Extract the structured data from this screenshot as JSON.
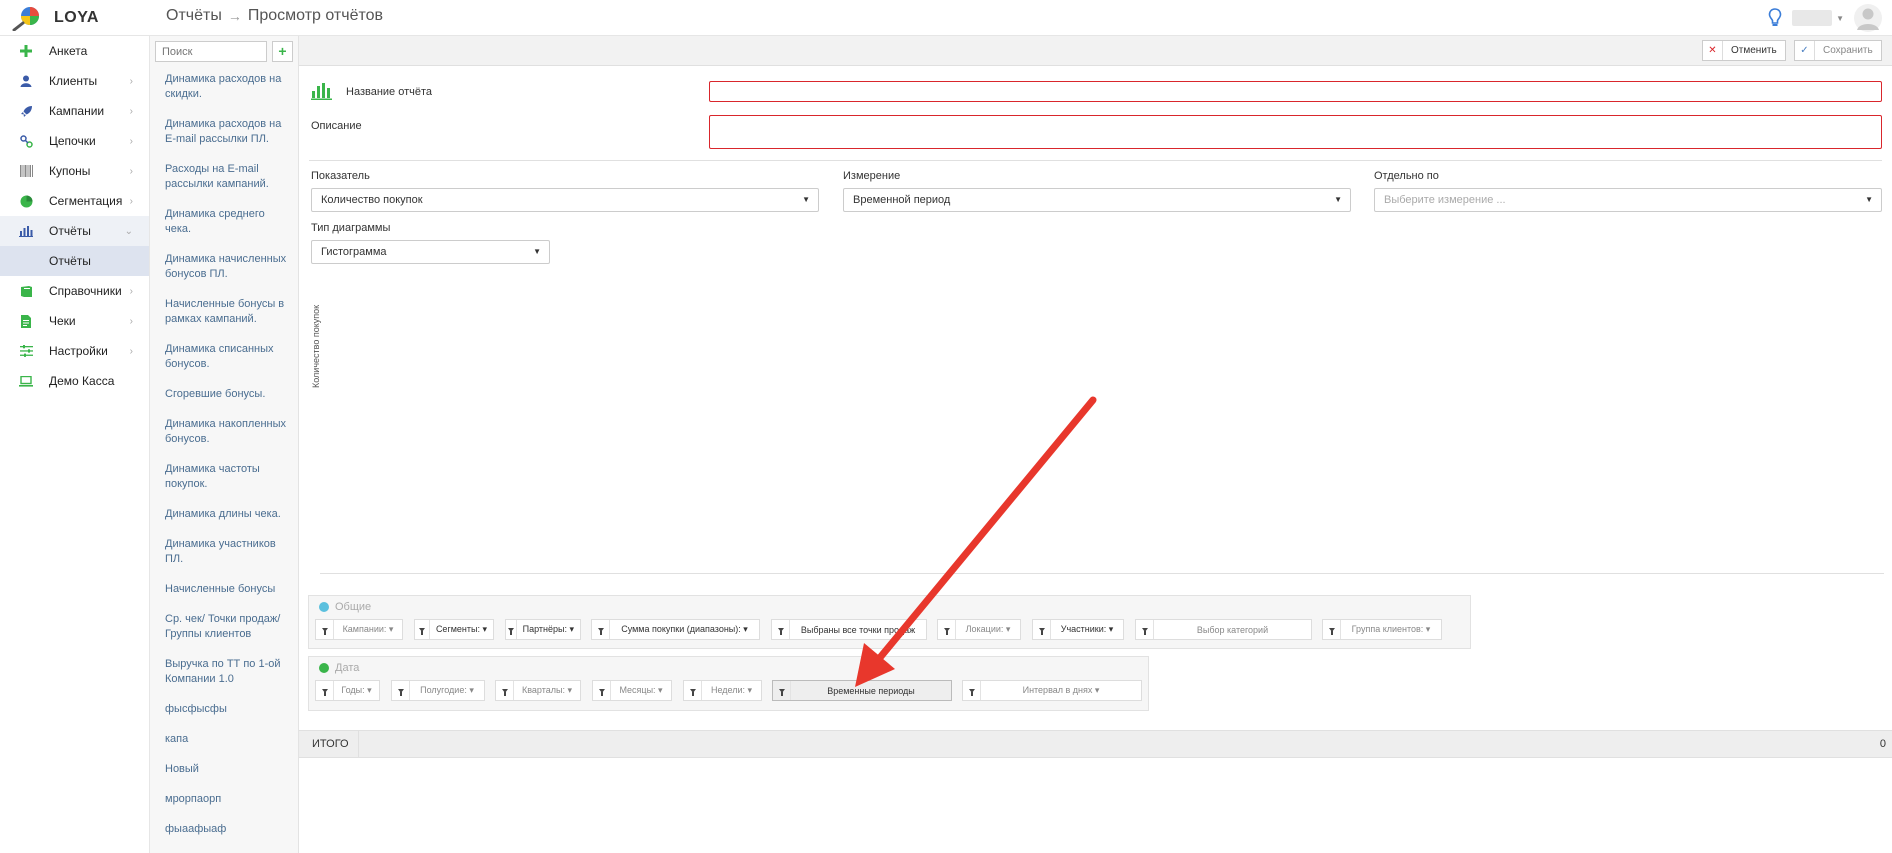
{
  "app": {
    "logo_text": "LOYA",
    "breadcrumb": [
      "Отчёты",
      "Просмотр отчётов"
    ]
  },
  "nav": {
    "items": [
      {
        "label": "Анкета",
        "icon": "plus-icon",
        "has_chevron": false
      },
      {
        "label": "Клиенты",
        "icon": "user-icon",
        "has_chevron": true
      },
      {
        "label": "Кампании",
        "icon": "rocket-icon",
        "has_chevron": true
      },
      {
        "label": "Цепочки",
        "icon": "chain-icon",
        "has_chevron": true
      },
      {
        "label": "Купоны",
        "icon": "barcode-icon",
        "has_chevron": true
      },
      {
        "label": "Сегментация",
        "icon": "pie-chart-icon",
        "has_chevron": true
      },
      {
        "label": "Отчёты",
        "icon": "bar-chart-icon",
        "has_chevron": true,
        "active": true
      },
      {
        "label": "Справочники",
        "icon": "book-icon",
        "has_chevron": true
      },
      {
        "label": "Чеки",
        "icon": "receipt-icon",
        "has_chevron": true
      },
      {
        "label": "Настройки",
        "icon": "sliders-icon",
        "has_chevron": true
      },
      {
        "label": "Демо Касса",
        "icon": "laptop-icon",
        "has_chevron": false
      }
    ],
    "sub_item": "Отчёты"
  },
  "report_list": {
    "search_placeholder": "Поиск",
    "add_label": "+",
    "items": [
      "Динамика расходов на скидки.",
      "Динамика расходов на E-mail рассылки ПЛ.",
      "Расходы на E-mail рассылки кампаний.",
      "Динамика среднего чека.",
      "Динамика начисленных бонусов ПЛ.",
      "Начисленные бонусы в рамках кампаний.",
      "Динамика списанных бонусов.",
      "Сгоревшие бонусы.",
      "Динамика накопленных бонусов.",
      "Динамика частоты покупок.",
      "Динамика длины чека.",
      "Динамика участников ПЛ.",
      "Начисленные бонусы",
      "Ср. чек/ Точки продаж/ Группы клиентов",
      "Выручка по ТТ по 1-ой Компании 1.0",
      "фысфысфы",
      "капа",
      "Новый",
      "мрорпаорп",
      "фыаафыаф"
    ]
  },
  "actions": {
    "cancel_label": "Отменить",
    "save_label": "Сохранить"
  },
  "form": {
    "report_name_label": "Название отчёта",
    "report_name_value": "",
    "description_label": "Описание",
    "description_value": "",
    "indicator_label": "Показатель",
    "indicator_value": "Количество покупок",
    "dimension_label": "Измерение",
    "dimension_value": "Временной период",
    "split_label": "Отдельно по",
    "split_placeholder": "Выберите измерение ...",
    "chart_type_label": "Тип диаграммы",
    "chart_type_value": "Гистограмма"
  },
  "chart": {
    "y_axis_label": "Количество покупок"
  },
  "filters": {
    "general": {
      "title": "Общие",
      "color": "#5bc0de",
      "chips": [
        {
          "label": "Кампании: ▾",
          "muted": true
        },
        {
          "label": "Сегменты: ▾",
          "muted": false
        },
        {
          "label": "Партнёры: ▾",
          "muted": false
        },
        {
          "label": "Сумма покупки (диапазоны): ▾",
          "muted": false
        },
        {
          "label": "Выбраны все точки продаж",
          "muted": false
        },
        {
          "label": "Локации: ▾",
          "muted": true
        },
        {
          "label": "Участники: ▾",
          "muted": false
        },
        {
          "label": "Выбор категорий",
          "muted": true
        },
        {
          "label": "Группа клиентов: ▾",
          "muted": true
        }
      ]
    },
    "date": {
      "title": "Дата",
      "color": "#3ab54a",
      "chips": [
        {
          "label": "Годы: ▾",
          "muted": true
        },
        {
          "label": "Полугодие: ▾",
          "muted": true
        },
        {
          "label": "Кварталы: ▾",
          "muted": true
        },
        {
          "label": "Месяцы: ▾",
          "muted": true
        },
        {
          "label": "Недели: ▾",
          "muted": true
        },
        {
          "label": "Временные периоды",
          "muted": false,
          "active": true
        },
        {
          "label": "Интервал в днях ▾",
          "muted": true
        }
      ]
    }
  },
  "total": {
    "label": "ИТОГО",
    "value": "0"
  },
  "colors": {
    "accent_green": "#3ab54a",
    "error_red": "#d9262c",
    "annotation_arrow": "#e8372c"
  }
}
